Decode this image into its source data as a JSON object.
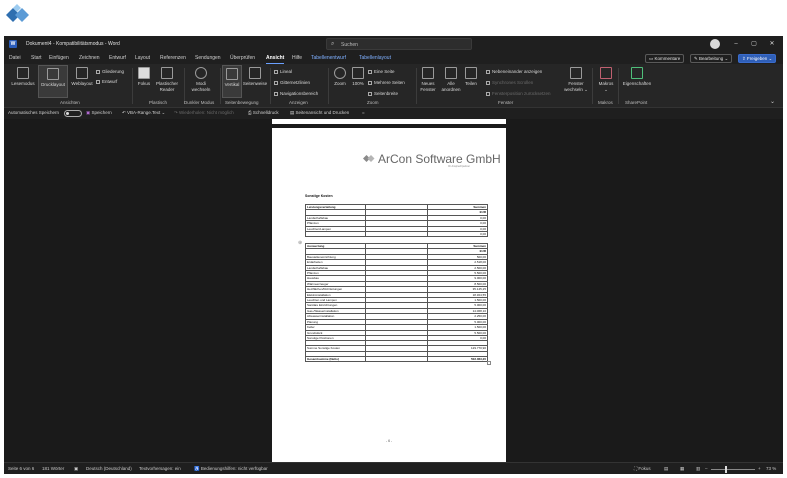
{
  "window": {
    "title": "Dokument4 - Kompatibilitätsmodus - Word",
    "search_placeholder": "Suchen",
    "minimize": "–",
    "maximize": "▢",
    "close": "✕"
  },
  "menu": {
    "items": [
      "Datei",
      "Start",
      "Einfügen",
      "Zeichnen",
      "Entwurf",
      "Layout",
      "Referenzen",
      "Sendungen",
      "Überprüfen",
      "Ansicht",
      "Hilfe",
      "Tabellenentwurf",
      "Tabellenlayout"
    ],
    "active": "Ansicht",
    "comments": "Kommentare",
    "editing": "Bearbeitung ⌄",
    "share": "Freigeben ⌄"
  },
  "ribbon": {
    "ansichten": {
      "lesemodus": "Lesemodus",
      "drucklayout": "Drucklayout",
      "weblayout": "Weblayout",
      "gliederung": "Gliederung",
      "entwurf": "Entwurf",
      "group": "Ansichten"
    },
    "plastisch": {
      "fokus": "Fokus",
      "reader_1": "Plastischer",
      "reader_2": "Reader",
      "group": "Plastisch"
    },
    "dunkler_modus": {
      "modi_1": "Modi",
      "modi_2": "wechseln",
      "group": "Dunkler Modus"
    },
    "seitenbewegung": {
      "vertikal": "Vertikal",
      "seitenweise": "Seitenweise",
      "group": "Seitenbewegung"
    },
    "anzeigen": {
      "lineal": "Lineal",
      "gitternetzlinien": "Gitternetzlinien",
      "navigationsbereich": "Navigationsbereich",
      "group": "Anzeigen"
    },
    "zoom": {
      "zoom": "Zoom",
      "pct": "100%",
      "eine_seite": "Eine Seite",
      "mehrere_seiten": "Mehrere Seiten",
      "seitenbreite": "Seitenbreite",
      "group": "Zoom"
    },
    "fenster": {
      "neues_1": "Neues",
      "neues_2": "Fenster",
      "alle_1": "Alle",
      "alle_2": "anordnen",
      "teilen": "Teilen",
      "nebeneinander": "Nebeneinander anzeigen",
      "synchroner": "Synchrones Scrollen",
      "zuruecksetzen": "Fensterposition zurücksetzen",
      "wechseln_1": "Fenster",
      "wechseln_2": "wechseln ⌄",
      "group": "Fenster"
    },
    "makros": {
      "label_1": "Makros",
      "label_2": "⌄",
      "group": "Makros"
    },
    "sharepoint": {
      "label": "Eigenschaften",
      "group": "SharePoint"
    }
  },
  "qat": {
    "autosave": "Automatisches Speichern",
    "save": "Speichern",
    "vba": "VBA-Range.Text ⌄",
    "disabled": "Wiederholen: Nicht möglich",
    "quickprint": "Schnelldruck",
    "preview": "Seitenansicht und Drucken",
    "more": "="
  },
  "document": {
    "brand": "ArCon Software GmbH",
    "brand_sub": "Ihr Ansprechpartner",
    "section_title": "Sonstige Kosten",
    "table1": {
      "header": [
        "Leistungsverteilung",
        "",
        "Summen"
      ],
      "subheader": [
        "",
        "",
        "EUR"
      ],
      "rows": [
        [
          "Landschaftsbau",
          "",
          "0,00"
        ],
        [
          "Pflanzen",
          "",
          "0,00"
        ],
        [
          "Leuchten/Lampen",
          "",
          "0,00"
        ],
        [
          "",
          "",
          "0,00"
        ]
      ]
    },
    "table2": {
      "header": [
        "Auswertung",
        "",
        "Summen"
      ],
      "subheader": [
        "",
        "",
        "EUR"
      ],
      "rows": [
        [
          "Baustelleneinrichtung",
          "",
          "500,00"
        ],
        [
          "Erdarbeiten",
          "",
          "2.518,00"
        ],
        [
          "Landschaftsbau",
          "",
          "2.500,00"
        ],
        [
          "Pflanzen",
          "",
          "5.500,00"
        ],
        [
          "Hausbau",
          "",
          "9.000,00"
        ],
        [
          "Wärmeerzeuger",
          "",
          "8.500,00"
        ],
        [
          "Heizflächen/Rohrleitungen",
          "",
          "35.145,25"
        ],
        [
          "Elektroinstallation",
          "",
          "18.304,55"
        ],
        [
          "Leuchten und Lampen",
          "",
          "1.500,00"
        ],
        [
          "Sanitäre Einrichtungen",
          "",
          "5.000,00"
        ],
        [
          "Gas-/Wasserinstallation",
          "",
          "14.068,10"
        ],
        [
          "Abwasserinstallation",
          "",
          "2.250,00"
        ],
        [
          "Planung",
          "",
          "5.000,00"
        ],
        [
          "Keller",
          "",
          "1.500,00"
        ],
        [
          "Grundstück",
          "",
          "5.500,00"
        ],
        [
          "Sonstige Positionen",
          "",
          "0,00"
        ],
        [
          "",
          "",
          ""
        ],
        [
          "Summe Sonstige Kosten",
          "",
          "129.770,90"
        ],
        [
          "",
          "",
          ""
        ],
        [
          "Gesamtsumme (Netto)",
          "",
          "502.063,20"
        ]
      ]
    },
    "page_number": "- 6 -"
  },
  "status": {
    "page": "Seite 6 von 6",
    "words": "181 Wörter",
    "language": "Deutsch (Deutschland)",
    "predictions": "Textvorhersagen: ein",
    "accessibility": "Bedienungshilfen: nicht verfügbar",
    "focus": "Fokus",
    "zoom": "73 %",
    "zoom_value_percent": 73
  }
}
